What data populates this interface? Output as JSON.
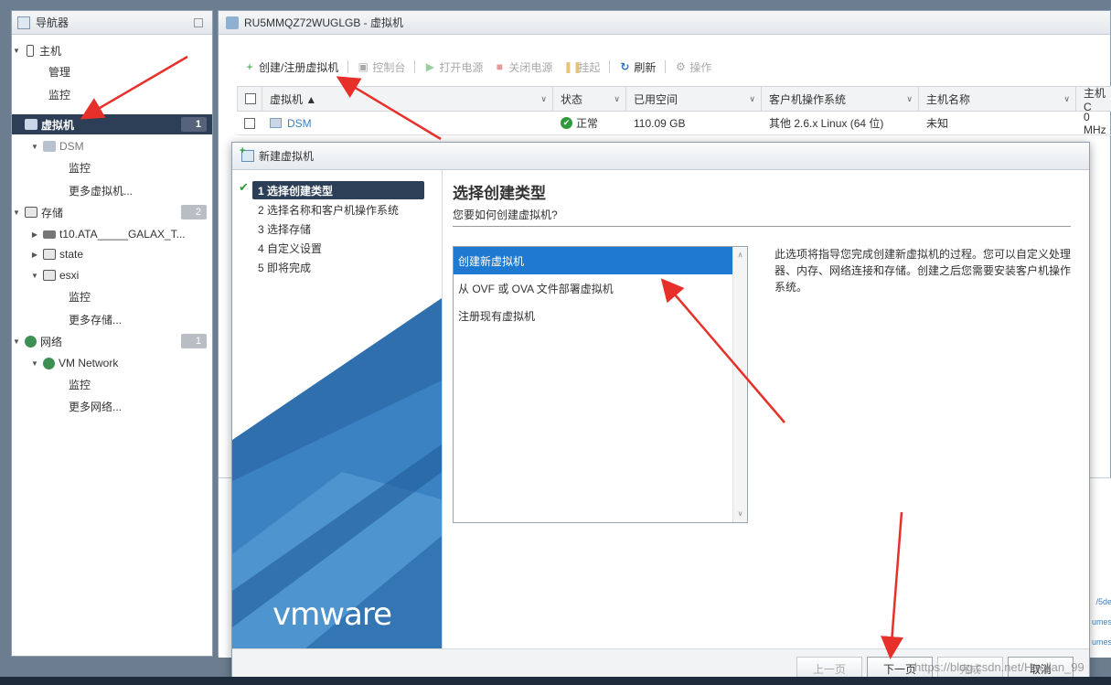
{
  "navigator": {
    "title": "导航器",
    "items": [
      {
        "label": "主机",
        "level": 0,
        "expanded": true,
        "icon": "host-icon"
      },
      {
        "label": "管理",
        "level": 1
      },
      {
        "label": "监控",
        "level": 1
      },
      {
        "label": "虚拟机",
        "level": 0,
        "selected": true,
        "badge": "1",
        "icon": "vm-icon"
      },
      {
        "label": "DSM",
        "level": 1,
        "expanded": true,
        "icon": "vm-icon"
      },
      {
        "label": "监控",
        "level": 2
      },
      {
        "label": "更多虚拟机...",
        "level": 2
      },
      {
        "label": "存储",
        "level": 0,
        "badge": "2",
        "icon": "storage-icon"
      },
      {
        "label": "t10.ATA_____GALAX_T...",
        "level": 1,
        "icon": "disk-icon"
      },
      {
        "label": "state",
        "level": 1,
        "icon": "datastore-icon"
      },
      {
        "label": "esxi",
        "level": 1,
        "expanded": true,
        "icon": "datastore-icon"
      },
      {
        "label": "监控",
        "level": 2
      },
      {
        "label": "更多存储...",
        "level": 2
      },
      {
        "label": "网络",
        "level": 0,
        "badge": "1",
        "icon": "network-icon"
      },
      {
        "label": "VM Network",
        "level": 1,
        "icon": "network-icon"
      },
      {
        "label": "监控",
        "level": 2
      },
      {
        "label": "更多网络...",
        "level": 2
      }
    ]
  },
  "main": {
    "title": "RU5MMQZ72WUGLGB - 虚拟机",
    "toolbar": [
      {
        "label": "创建/注册虚拟机",
        "icon": "create-vm-icon",
        "enabled": true
      },
      {
        "label": "控制台",
        "icon": "console-icon",
        "enabled": false
      },
      {
        "label": "打开电源",
        "icon": "power-on-icon",
        "enabled": false
      },
      {
        "label": "关闭电源",
        "icon": "power-off-icon",
        "enabled": false
      },
      {
        "label": "挂起",
        "icon": "suspend-icon",
        "enabled": false
      },
      {
        "label": "刷新",
        "icon": "refresh-icon",
        "enabled": true
      },
      {
        "label": "操作",
        "icon": "gear-icon",
        "enabled": false
      }
    ],
    "columns": [
      "虚拟机 ▲",
      "状态",
      "已用空间",
      "客户机操作系统",
      "主机名称",
      "主机 C"
    ],
    "rows": [
      {
        "name": "DSM",
        "status": "正常",
        "used": "110.09 GB",
        "os": "其他 2.6.x Linux (64 位)",
        "hostname": "未知",
        "cpu": "0 MHz"
      }
    ],
    "recent_snippets": [
      "/5de",
      "umes",
      "umes"
    ]
  },
  "dialog": {
    "title": "新建虚拟机",
    "steps": [
      "1 选择创建类型",
      "2 选择名称和客户机操作系统",
      "3 选择存储",
      "4 自定义设置",
      "5 即将完成"
    ],
    "brand": "vmware",
    "heading": "选择创建类型",
    "subheading": "您要如何创建虚拟机?",
    "options": [
      "创建新虚拟机",
      "从 OVF 或 OVA 文件部署虚拟机",
      "注册现有虚拟机"
    ],
    "description": "此选项将指导您完成创建新虚拟机的过程。您可以自定义处理器、内存、网络连接和存储。创建之后您需要安装客户机操作系统。",
    "buttons": {
      "back": "上一页",
      "next": "下一页",
      "finish": "完成",
      "cancel": "取消"
    }
  },
  "watermark": "https://blog.csdn.net/Haojian_99"
}
